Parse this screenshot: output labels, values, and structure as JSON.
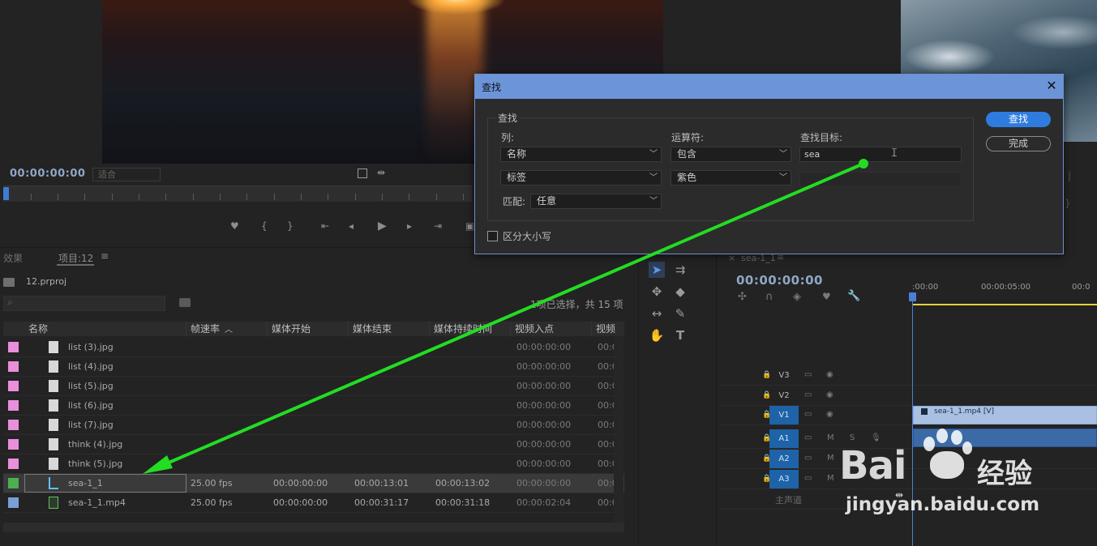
{
  "source_monitor": {
    "timecode": "00:00:00:00",
    "fit_label": "适合"
  },
  "find_dialog": {
    "title": "查找",
    "group_label": "查找",
    "column_label": "列:",
    "operator_label": "运算符:",
    "target_label": "查找目标:",
    "column_1": "名称",
    "operator_1": "包含",
    "target_1": "sea",
    "column_2": "标签",
    "operator_2": "紫色",
    "target_2": "",
    "match_label": "匹配:",
    "match_value": "任意",
    "find_button": "查找",
    "done_button": "完成",
    "case_sensitive_label": "区分大小写",
    "case_sensitive_checked": false
  },
  "project_panel": {
    "tab_effects": "效果",
    "tab_project": "项目:12",
    "project_file": "12.prproj",
    "selection_status": "1项已选择，共 15 项",
    "columns": [
      "名称",
      "帧速率",
      "媒体开始",
      "媒体结束",
      "媒体持续时间",
      "视频入点",
      "视频出"
    ],
    "rows": [
      {
        "label_color": "#e98fdc",
        "name": "list (3).jpg",
        "fps": "",
        "start": "",
        "end": "",
        "duration": "",
        "in": "00:00:00:00",
        "out": "00:0"
      },
      {
        "label_color": "#e98fdc",
        "name": "list (4).jpg",
        "fps": "",
        "start": "",
        "end": "",
        "duration": "",
        "in": "00:00:00:00",
        "out": "00:0"
      },
      {
        "label_color": "#e98fdc",
        "name": "list (5).jpg",
        "fps": "",
        "start": "",
        "end": "",
        "duration": "",
        "in": "00:00:00:00",
        "out": "00:0"
      },
      {
        "label_color": "#e98fdc",
        "name": "list (6).jpg",
        "fps": "",
        "start": "",
        "end": "",
        "duration": "",
        "in": "00:00:00:00",
        "out": "00:0"
      },
      {
        "label_color": "#e98fdc",
        "name": "list (7).jpg",
        "fps": "",
        "start": "",
        "end": "",
        "duration": "",
        "in": "00:00:00:00",
        "out": "00:0"
      },
      {
        "label_color": "#e98fdc",
        "name": "think (4).jpg",
        "fps": "",
        "start": "",
        "end": "",
        "duration": "",
        "in": "00:00:00:00",
        "out": "00:0"
      },
      {
        "label_color": "#e98fdc",
        "name": "think (5).jpg",
        "fps": "",
        "start": "",
        "end": "",
        "duration": "",
        "in": "00:00:00:00",
        "out": "00:0"
      },
      {
        "label_color": "#4caf50",
        "name": "sea-1_1",
        "fps": "25.00 fps",
        "start": "00:00:00:00",
        "end": "00:00:13:01",
        "duration": "00:00:13:02",
        "in": "00:00:00:00",
        "out": "00:0"
      },
      {
        "label_color": "#7a9fd6",
        "name": "sea-1_1.mp4",
        "fps": "25.00 fps",
        "start": "00:00:00:00",
        "end": "00:00:31:17",
        "duration": "00:00:31:18",
        "in": "00:00:02:04",
        "out": "00:0"
      }
    ]
  },
  "timeline": {
    "tab_label": "sea-1_1",
    "timecode": "00:00:00:00",
    "ruler_labels": [
      ":00:00",
      "00:00:05:00",
      "00:0"
    ],
    "tracks": [
      "V3",
      "V2",
      "V1",
      "A1",
      "A2",
      "A3"
    ],
    "master_label": "主声道",
    "clip_label": "sea-1_1.mp4 [V]"
  },
  "watermark": {
    "logo": "Bai",
    "logo_suffix": "经验",
    "url": "jingyan.baidu.com"
  },
  "colors": {
    "accent": "#2f7ce0",
    "dialog_title": "#6c94d9",
    "arrow": "#22dd22"
  }
}
